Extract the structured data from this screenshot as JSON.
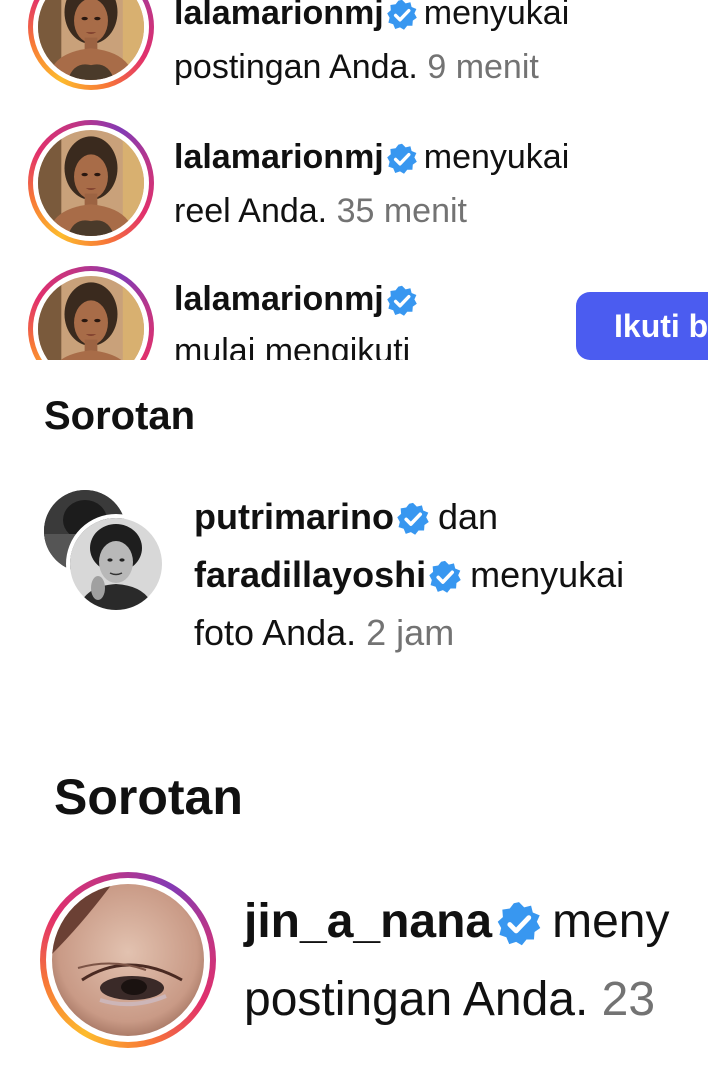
{
  "panel_a": {
    "notifications": [
      {
        "username": "lalamarionmj",
        "action": "menyukai",
        "object": "postingan Anda.",
        "time": "9 menit"
      },
      {
        "username": "lalamarionmj",
        "action": "menyukai",
        "object": "reel Anda.",
        "time": "35 menit"
      },
      {
        "username": "lalamarionmj",
        "action": "",
        "object": "mulai mengikuti",
        "time": ""
      }
    ],
    "follow_button_label": "Ikuti b"
  },
  "panel_b": {
    "section_title": "Sorotan",
    "notification": {
      "user1": "putrimarino",
      "connector": "dan",
      "user2": "faradillayoshi",
      "action": "menyukai",
      "object": "foto Anda.",
      "time": "2 jam"
    }
  },
  "panel_c": {
    "section_title": "Sorotan",
    "notification": {
      "username": "jin_a_nana",
      "action": "meny",
      "object": "postingan Anda.",
      "time": "23"
    }
  },
  "colors": {
    "verified": "#3897f0",
    "follow_button": "#4b5cf0",
    "time_text": "#737373"
  }
}
